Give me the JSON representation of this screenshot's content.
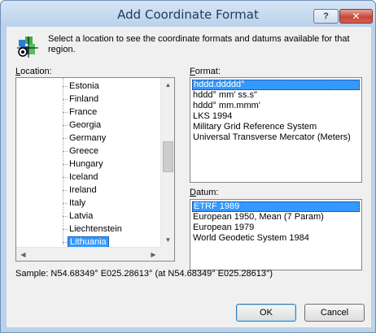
{
  "window": {
    "title": "Add Coordinate Format",
    "help_label": "?",
    "close_label": "✕"
  },
  "intro_text": "Select a location to see the coordinate formats and datums available for that region.",
  "location": {
    "label_accel": "L",
    "label_rest": "ocation:",
    "items": [
      {
        "label": "Estonia"
      },
      {
        "label": "Finland"
      },
      {
        "label": "France"
      },
      {
        "label": "Georgia"
      },
      {
        "label": "Germany"
      },
      {
        "label": "Greece"
      },
      {
        "label": "Hungary"
      },
      {
        "label": "Iceland"
      },
      {
        "label": "Ireland"
      },
      {
        "label": "Italy"
      },
      {
        "label": "Latvia"
      },
      {
        "label": "Liechtenstein"
      },
      {
        "label": "Lithuania"
      }
    ],
    "selected": "Lithuania"
  },
  "format": {
    "label_accel": "F",
    "label_rest": "ormat:",
    "options": [
      "hddd.ddddd°",
      "hddd° mm' ss.s\"",
      "hddd° mm.mmm'",
      "LKS 1994",
      "Military Grid Reference System",
      "Universal Transverse Mercator (Meters)"
    ],
    "selected": "hddd.ddddd°"
  },
  "datum": {
    "label_accel": "D",
    "label_rest": "atum:",
    "options": [
      "ETRF 1989",
      "European 1950, Mean (7 Param)",
      "European 1979",
      "World Geodetic System 1984"
    ],
    "selected": "ETRF 1989"
  },
  "sample_text": "Sample: N54.68349°  E025.28613° (at N54.68349°  E025.28613°)",
  "buttons": {
    "ok": "OK",
    "cancel": "Cancel"
  },
  "icons": {
    "app": "globe-grid-icon",
    "scroll_up": "triangle-up-icon",
    "scroll_down": "triangle-down-icon",
    "scroll_left": "triangle-left-icon",
    "scroll_right": "triangle-right-icon"
  },
  "colors": {
    "selection": "#3399ff",
    "title_bar": "#bad1ea",
    "close_button": "#c7483a",
    "dialog_body": "#f0f0f0"
  }
}
